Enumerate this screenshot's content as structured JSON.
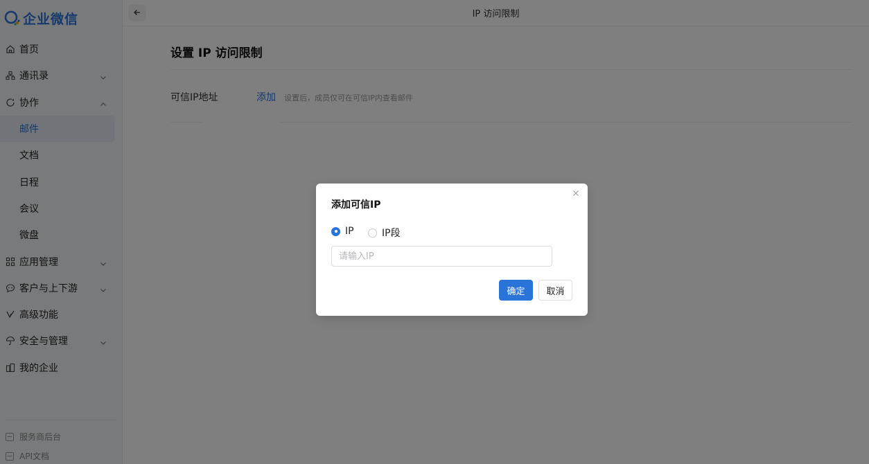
{
  "app": {
    "logo_text": "企业微信"
  },
  "sidebar": {
    "items": [
      {
        "label": "首页",
        "icon": "home-icon"
      },
      {
        "label": "通讯录",
        "icon": "org-chart-icon",
        "expandable": true,
        "expanded": false
      },
      {
        "label": "协作",
        "icon": "collaboration-icon",
        "expandable": true,
        "expanded": true
      },
      {
        "label": "邮件",
        "sub": true,
        "active": true
      },
      {
        "label": "文档",
        "sub": true
      },
      {
        "label": "日程",
        "sub": true
      },
      {
        "label": "会议",
        "sub": true
      },
      {
        "label": "微盘",
        "sub": true
      },
      {
        "label": "应用管理",
        "icon": "apps-grid-icon",
        "expandable": true,
        "expanded": false
      },
      {
        "label": "客户与上下游",
        "icon": "chat-bubble-icon",
        "expandable": true,
        "expanded": false
      },
      {
        "label": "高级功能",
        "icon": "advanced-icon"
      },
      {
        "label": "安全与管理",
        "icon": "umbrella-icon",
        "expandable": true,
        "expanded": false
      },
      {
        "label": "我的企业",
        "icon": "building-icon"
      }
    ],
    "footer": [
      {
        "label": "服务商后台",
        "icon": "console-icon"
      },
      {
        "label": "API文档",
        "icon": "doc-icon"
      }
    ]
  },
  "header": {
    "title": "IP 访问限制"
  },
  "main": {
    "title": "设置 IP 访问限制",
    "row": {
      "label": "可信IP地址",
      "action": "添加",
      "hint": "设置后，成员仅可在可信IP内查看邮件"
    }
  },
  "modal": {
    "title": "添加可信IP",
    "radio_options": [
      {
        "label": "IP",
        "checked": true
      },
      {
        "label": "IP段",
        "checked": false
      }
    ],
    "input": {
      "placeholder": "请输入IP",
      "value": ""
    },
    "confirm_label": "确定",
    "cancel_label": "取消"
  },
  "colors": {
    "accent": "#2a73d8",
    "sidebar_bg": "#f3f4f6",
    "overlay": "rgba(0,0,0,0.5)"
  }
}
